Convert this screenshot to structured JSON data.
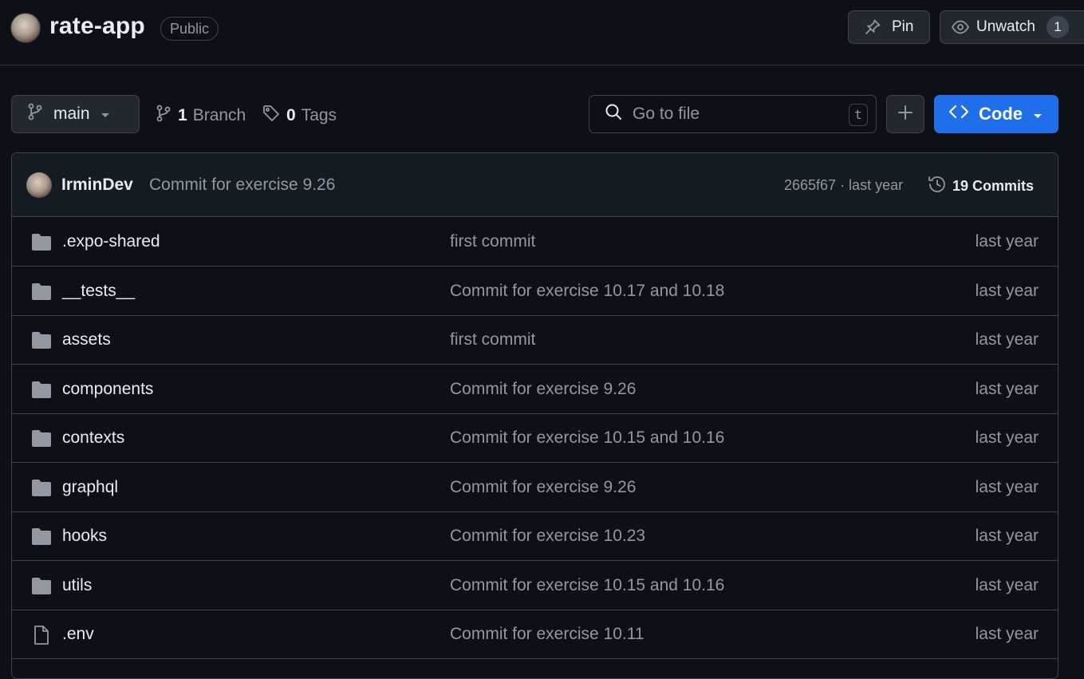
{
  "repo": {
    "name": "rate-app",
    "visibility": "Public"
  },
  "header_actions": {
    "pin_label": "Pin",
    "unwatch_label": "Unwatch",
    "watch_count": "1"
  },
  "toolbar": {
    "branch": "main",
    "branch_count": "1",
    "branch_label": "Branch",
    "tag_count": "0",
    "tag_label": "Tags",
    "search_placeholder": "Go to file",
    "search_shortcut": "t",
    "code_label": "Code"
  },
  "latest_commit": {
    "author": "IrminDev",
    "message": "Commit for exercise 9.26",
    "meta": "2665f67 · last year",
    "commits_label": "19 Commits"
  },
  "files": [
    {
      "type": "folder",
      "name": ".expo-shared",
      "commit": "first commit",
      "date": "last year"
    },
    {
      "type": "folder",
      "name": "__tests__",
      "commit": "Commit for exercise 10.17 and 10.18",
      "date": "last year"
    },
    {
      "type": "folder",
      "name": "assets",
      "commit": "first commit",
      "date": "last year"
    },
    {
      "type": "folder",
      "name": "components",
      "commit": "Commit for exercise 9.26",
      "date": "last year"
    },
    {
      "type": "folder",
      "name": "contexts",
      "commit": "Commit for exercise 10.15 and 10.16",
      "date": "last year"
    },
    {
      "type": "folder",
      "name": "graphql",
      "commit": "Commit for exercise 9.26",
      "date": "last year"
    },
    {
      "type": "folder",
      "name": "hooks",
      "commit": "Commit for exercise 10.23",
      "date": "last year"
    },
    {
      "type": "folder",
      "name": "utils",
      "commit": "Commit for exercise 10.15 and 10.16",
      "date": "last year"
    },
    {
      "type": "file",
      "name": ".env",
      "commit": "Commit for exercise 10.11",
      "date": "last year"
    }
  ],
  "colors": {
    "background": "#0d1117",
    "accent_button": "#1f6feb",
    "muted_text": "#9198a1",
    "border": "#3d444d"
  }
}
